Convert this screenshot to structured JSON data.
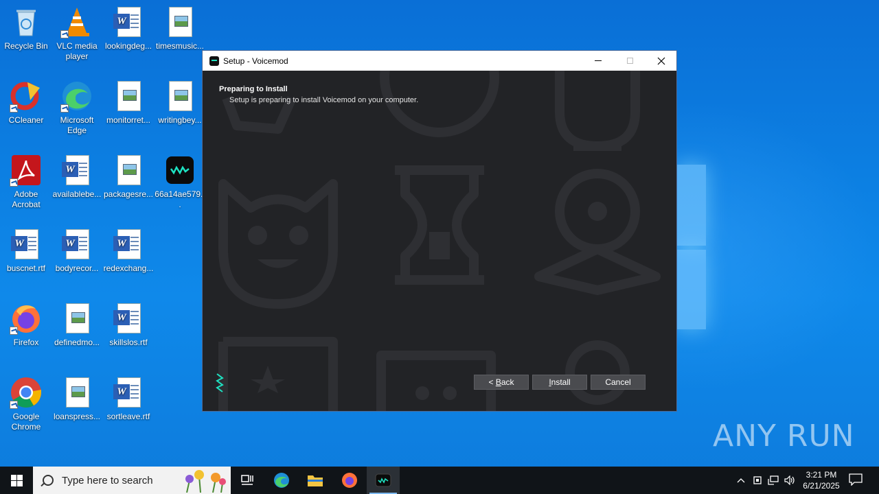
{
  "desktop": {
    "icons": [
      {
        "label": "Recycle Bin",
        "icon": "recycle-bin-icon"
      },
      {
        "label": "VLC media player",
        "icon": "vlc-icon"
      },
      {
        "label": "lookingdeg...",
        "icon": "word-doc-icon"
      },
      {
        "label": "timesmusic...",
        "icon": "image-file-icon"
      },
      {
        "label": "CCleaner",
        "icon": "ccleaner-icon"
      },
      {
        "label": "Microsoft Edge",
        "icon": "edge-icon"
      },
      {
        "label": "monitorret...",
        "icon": "image-file-icon"
      },
      {
        "label": "writingbey...",
        "icon": "image-file-icon"
      },
      {
        "label": "Adobe Acrobat",
        "icon": "acrobat-icon"
      },
      {
        "label": "availablebe...",
        "icon": "word-doc-icon"
      },
      {
        "label": "packagesre...",
        "icon": "image-file-icon"
      },
      {
        "label": "66a14ae579...",
        "icon": "voicemod-installer-icon"
      },
      {
        "label": "buscnet.rtf",
        "icon": "word-doc-icon"
      },
      {
        "label": "bodyrecor...",
        "icon": "word-doc-icon"
      },
      {
        "label": "redexchang...",
        "icon": "word-doc-icon"
      },
      {
        "label": "Firefox",
        "icon": "firefox-icon"
      },
      {
        "label": "definedmo...",
        "icon": "image-file-icon"
      },
      {
        "label": "skillslos.rtf",
        "icon": "word-doc-icon"
      },
      {
        "label": "Google Chrome",
        "icon": "chrome-icon"
      },
      {
        "label": "loanspress...",
        "icon": "image-file-icon"
      },
      {
        "label": "sortleave.rtf",
        "icon": "word-doc-icon"
      }
    ]
  },
  "setup_window": {
    "title": "Setup - Voicemod",
    "heading": "Preparing to Install",
    "subheading": "Setup is preparing to install Voicemod on your computer.",
    "buttons": {
      "back_prefix": "< ",
      "back_accel": "B",
      "back_rest": "ack",
      "install_accel": "I",
      "install_rest": "nstall",
      "cancel": "Cancel"
    }
  },
  "watermark": "ANY RUN",
  "taskbar": {
    "search_placeholder": "Type here to search",
    "time": "3:21 PM",
    "date": "6/21/2025"
  },
  "colors": {
    "accent": "#1ee3c2",
    "window_bg": "#222326",
    "button_bg": "#4a4b4f",
    "taskbar_bg": "#101418"
  }
}
